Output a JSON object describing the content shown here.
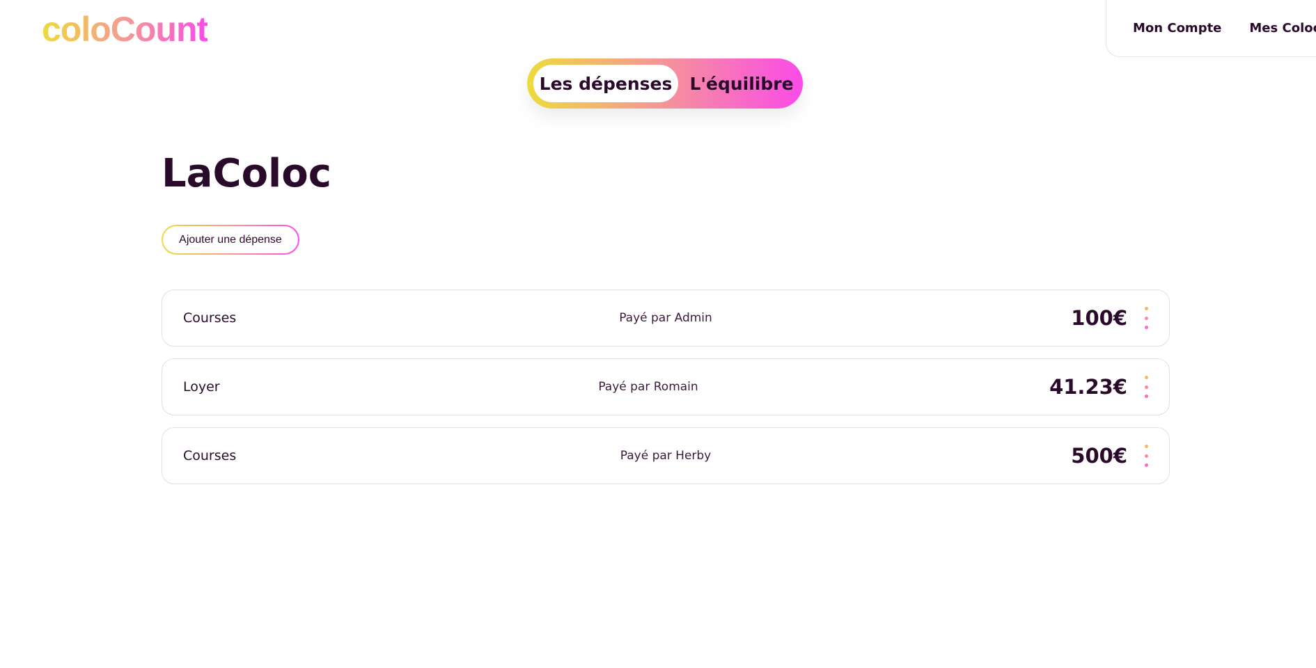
{
  "app": {
    "logo_text": "coloCount"
  },
  "nav": {
    "account_label": "Mon Compte",
    "colocs_label": "Mes Colocs"
  },
  "tabs": {
    "expenses_label": "Les dépenses",
    "balance_label": "L'équilibre",
    "active": "expenses"
  },
  "page": {
    "title": "LaColoc",
    "add_expense_label": "Ajouter une dépense"
  },
  "expenses": [
    {
      "name": "Courses",
      "payer": "Payé par Admin",
      "amount": "100€"
    },
    {
      "name": "Loyer",
      "payer": "Payé par Romain",
      "amount": "41.23€"
    },
    {
      "name": "Courses",
      "payer": "Payé par Herby",
      "amount": "500€"
    }
  ],
  "colors": {
    "gradient_start": "#eedb3c",
    "gradient_mid": "#f49a92",
    "gradient_end": "#fb4be8",
    "text_primary": "#2a0a2a"
  }
}
